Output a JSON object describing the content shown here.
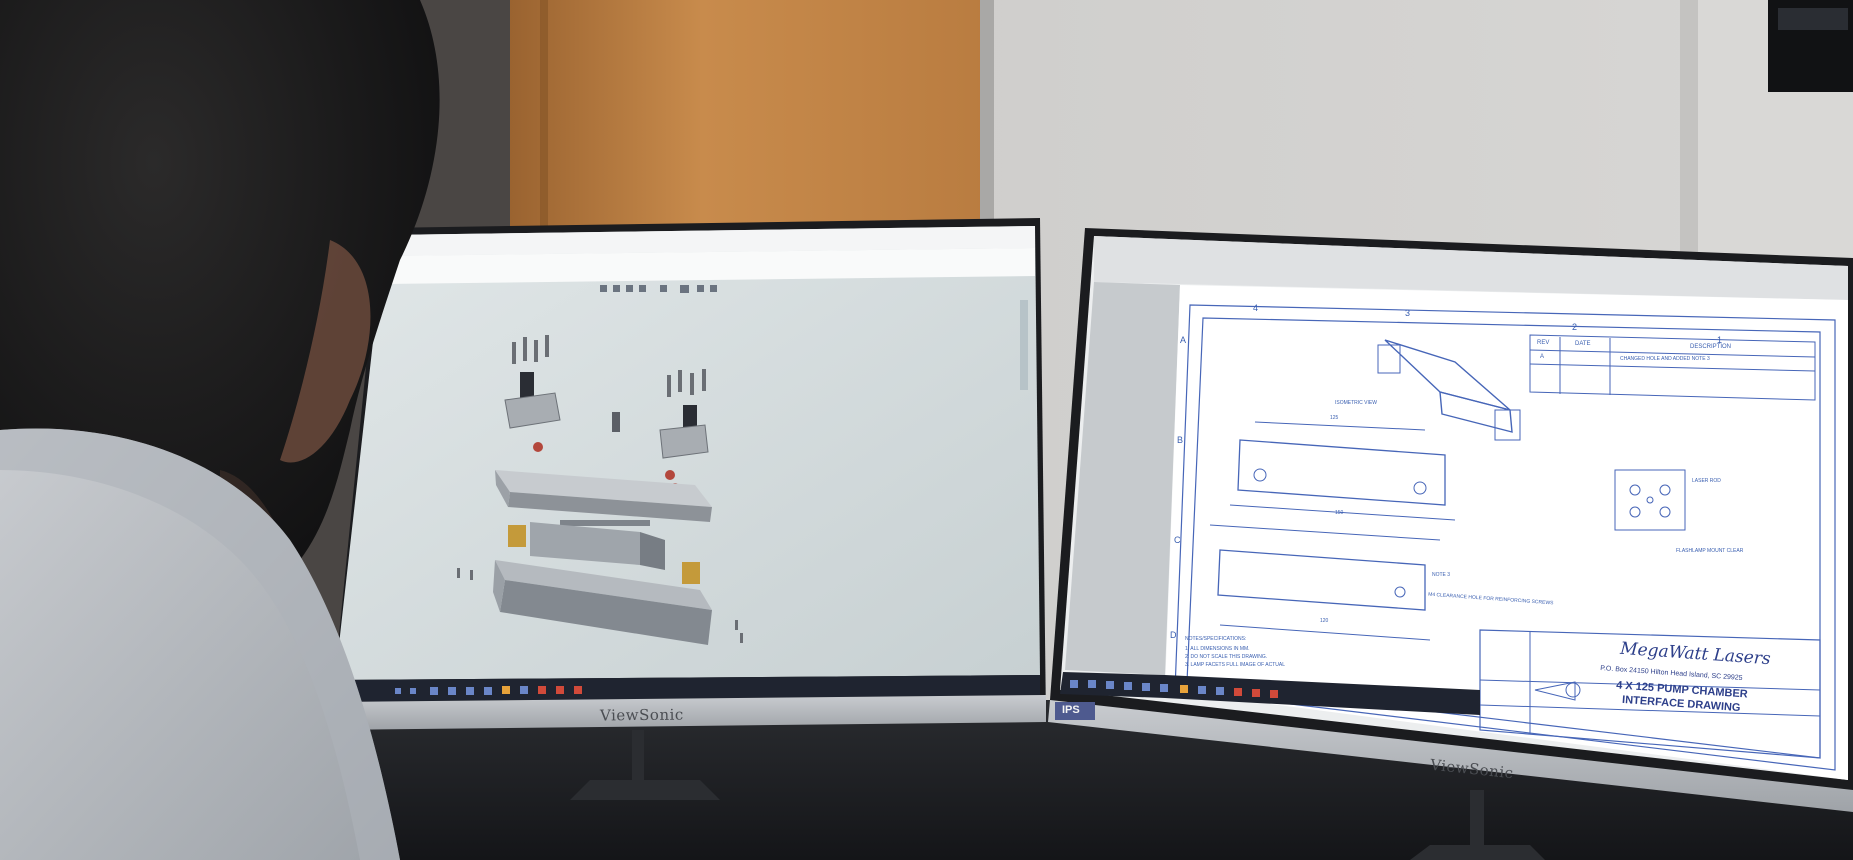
{
  "scene": {
    "left_monitor": {
      "brand": "ViewSonic"
    },
    "right_monitor": {
      "brand": "ViewSonic",
      "badge": "IPS"
    },
    "drawing": {
      "company": "MegaWatt Lasers",
      "address": "P.O. Box 24150   Hilton Head Island, SC 29925",
      "title_line1": "4 X 125 PUMP CHAMBER",
      "title_line2": "INTERFACE DRAWING",
      "isometric_label": "ISOMETRIC VIEW",
      "notes_label": "NOTES/SPECIFICATIONS:",
      "note1": "1. ALL DIMENSIONS IN MM.",
      "note2": "2. DO NOT SCALE THIS DRAWING.",
      "note3": "3. LAMP FACETS FULL IMAGE OF ACTUAL",
      "rev_col1": "REV",
      "rev_col2": "DATE",
      "rev_col3": "DESCRIPTION",
      "rev_entry_rev": "A",
      "rev_entry_desc": "CHANGED HOLE AND ADDED NOTE 3",
      "col_labels": [
        "4",
        "3",
        "2",
        "1"
      ],
      "row_labels": [
        "A",
        "B",
        "C",
        "D"
      ],
      "callout_laser_rod": "LASER ROD",
      "callout_flashlamp": "FLASHLAMP MOUNT CLEAR",
      "callout_note3": "NOTE 3",
      "callout_reinforcing": "M4 CLEARANCE HOLE FOR REINFORCING SCREWS",
      "dim_125": "125",
      "dim_120": "120",
      "dim_150": "150"
    },
    "colors": {
      "wall": "#c9c8c6",
      "door": "#c78a4a",
      "drawing_ink": "#3a5fb0",
      "taskbar": "#1f2430",
      "cad_bg": "#d4dcdd"
    }
  }
}
